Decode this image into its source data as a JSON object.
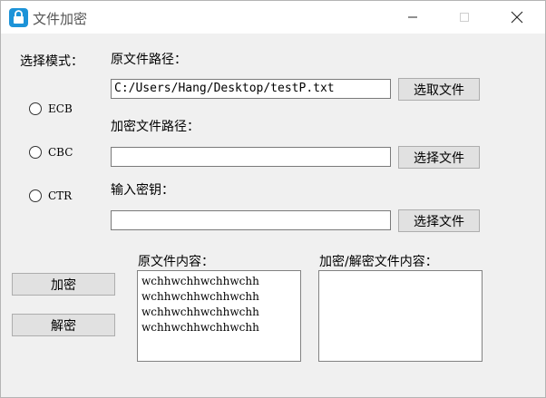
{
  "window": {
    "title": "文件加密",
    "icon": "lock-icon"
  },
  "mode": {
    "label": "选择模式：",
    "options": [
      "ECB",
      "CBC",
      "CTR"
    ]
  },
  "source_path": {
    "label": "原文件路径：",
    "value": "C:/Users/Hang/Desktop/testP.txt",
    "button": "选取文件"
  },
  "encrypted_path": {
    "label": "加密文件路径：",
    "value": "",
    "button": "选择文件"
  },
  "key": {
    "label": "输入密钥：",
    "value": "",
    "button": "选择文件"
  },
  "actions": {
    "encrypt": "加密",
    "decrypt": "解密"
  },
  "source_content": {
    "label": "原文件内容：",
    "lines": [
      "wchhwchhwchhwchh",
      "wchhwchhwchhwchh",
      "wchhwchhwchhwchh",
      "wchhwchhwchhwchh"
    ]
  },
  "result_content": {
    "label": "加密/解密文件内容：",
    "lines": []
  }
}
